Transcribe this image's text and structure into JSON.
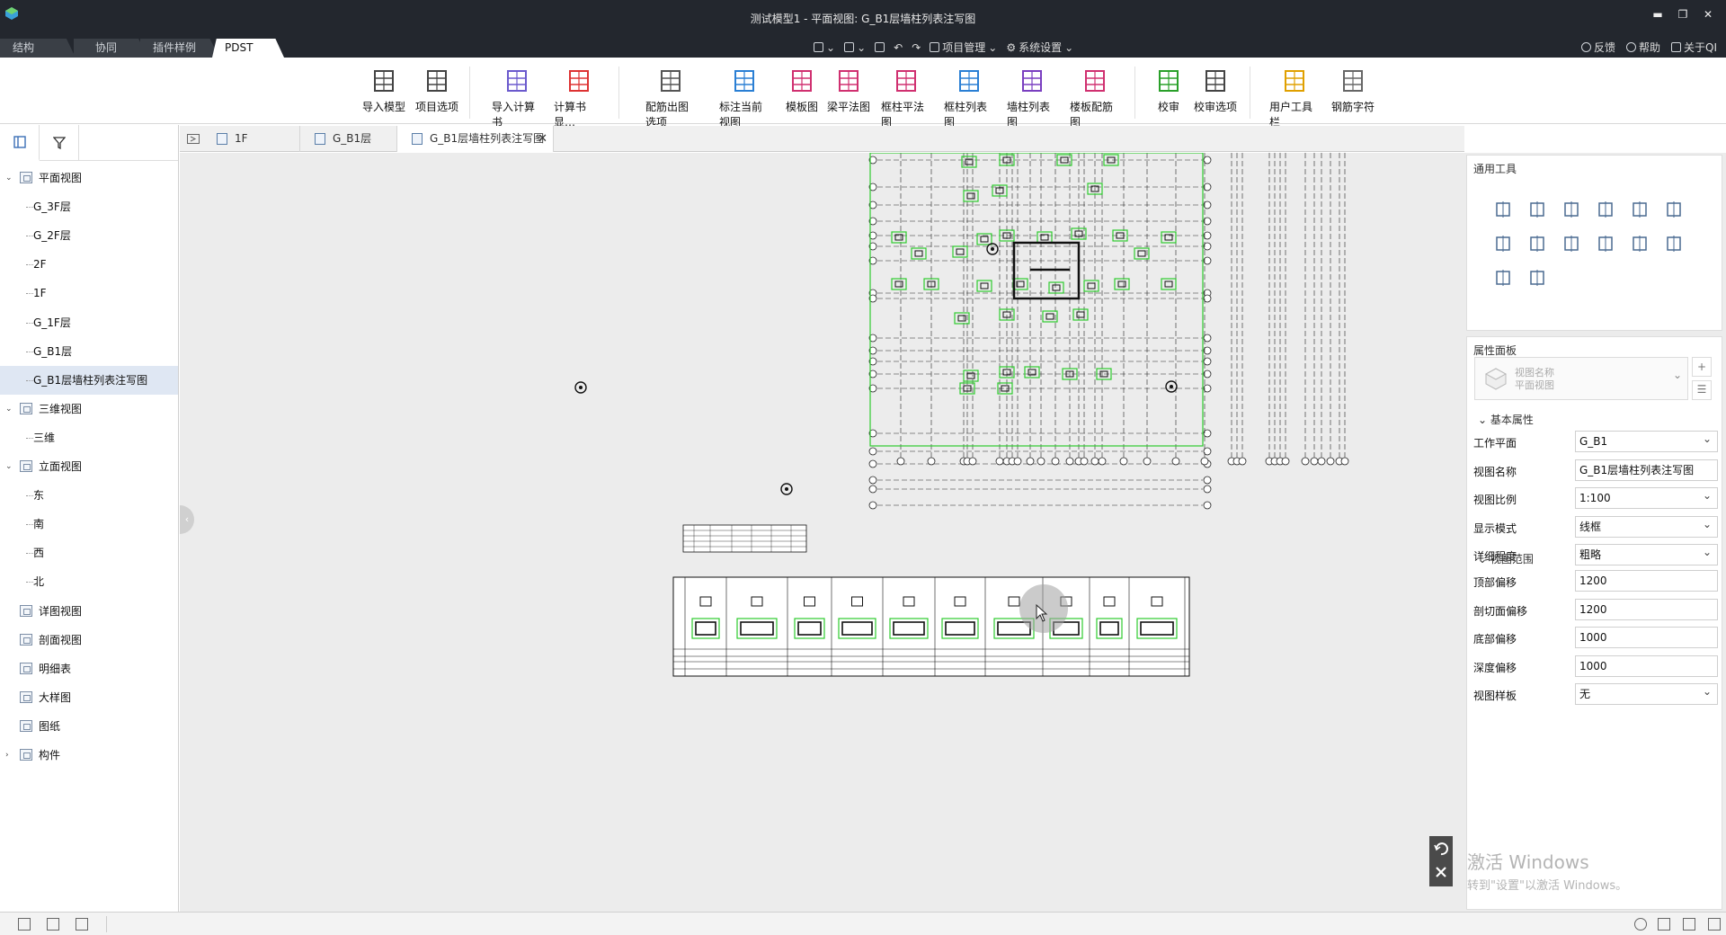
{
  "window": {
    "title": "测试模型1 - 平面视图: G_B1层墙柱列表注写图"
  },
  "ribbon_tabs": [
    {
      "label": "结构",
      "active": false
    },
    {
      "label": "协同",
      "active": false
    },
    {
      "label": "插件样例",
      "active": false
    },
    {
      "label": "PDST",
      "active": true
    }
  ],
  "quick_access": {
    "project": "项目管理",
    "system": "系统设置"
  },
  "help_menu": {
    "feedback": "反馈",
    "help": "帮助",
    "about": "关于QI"
  },
  "ribbon": [
    {
      "label": "导入模型",
      "icon": "building-icon"
    },
    {
      "label": "项目选项",
      "icon": "floors-icon"
    },
    {
      "label": "导入计算书",
      "icon": "import-calc-icon"
    },
    {
      "label": "计算书显…",
      "icon": "calc-display-icon"
    },
    {
      "label": "配筋出图选项",
      "icon": "gear-icon"
    },
    {
      "label": "标注当前视图",
      "icon": "annotate-view-icon"
    },
    {
      "label": "模板图",
      "icon": "template-icon"
    },
    {
      "label": "梁平法图",
      "icon": "beam-icon"
    },
    {
      "label": "框柱平法图",
      "icon": "column-icon"
    },
    {
      "label": "框柱列表图",
      "icon": "column-table-icon"
    },
    {
      "label": "墙柱列表图",
      "icon": "wall-table-icon"
    },
    {
      "label": "楼板配筋图",
      "icon": "slab-icon"
    },
    {
      "label": "校审",
      "icon": "check-icon"
    },
    {
      "label": "校审选项",
      "icon": "check-options-icon"
    },
    {
      "label": "用户工具栏",
      "icon": "star-icon"
    },
    {
      "label": "钢筋字符",
      "icon": "rebar-char-icon"
    }
  ],
  "tree": [
    {
      "label": "平面视图",
      "level": 0,
      "expand": "open",
      "icon": true
    },
    {
      "label": "G_3F层",
      "level": 1
    },
    {
      "label": "G_2F层",
      "level": 1
    },
    {
      "label": "2F",
      "level": 1
    },
    {
      "label": "1F",
      "level": 1
    },
    {
      "label": "G_1F层",
      "level": 1
    },
    {
      "label": "G_B1层",
      "level": 1
    },
    {
      "label": "G_B1层墙柱列表注写图",
      "level": 1,
      "selected": true
    },
    {
      "label": "三维视图",
      "level": 0,
      "expand": "open",
      "icon": true
    },
    {
      "label": "三维",
      "level": 1
    },
    {
      "label": "立面视图",
      "level": 0,
      "expand": "open",
      "icon": true
    },
    {
      "label": "东",
      "level": 1
    },
    {
      "label": "南",
      "level": 1
    },
    {
      "label": "西",
      "level": 1
    },
    {
      "label": "北",
      "level": 1
    },
    {
      "label": "详图视图",
      "level": 0,
      "icon": true
    },
    {
      "label": "剖面视图",
      "level": 0,
      "icon": true
    },
    {
      "label": "明细表",
      "level": 0,
      "icon": true
    },
    {
      "label": "大样图",
      "level": 0,
      "icon": true
    },
    {
      "label": "图纸",
      "level": 0,
      "icon": true
    },
    {
      "label": "构件",
      "level": 0,
      "expand": "closed",
      "icon": true
    }
  ],
  "doc_tabs": [
    {
      "label": "1F",
      "active": false
    },
    {
      "label": "G_B1层",
      "active": false
    },
    {
      "label": "G_B1层墙柱列表注写图",
      "active": true
    }
  ],
  "tools_panel": {
    "title": "通用工具"
  },
  "props_panel": {
    "title": "属性面板",
    "type_line1": "视图名称",
    "type_line2": "平面视图",
    "group_basic": "基本属性",
    "group_range": "视图范围",
    "basic": [
      {
        "label": "工作平面",
        "value": "G_B1",
        "select": true
      },
      {
        "label": "视图名称",
        "value": "G_B1层墙柱列表注写图",
        "select": false
      },
      {
        "label": "视图比例",
        "value": "1:100",
        "select": true
      },
      {
        "label": "显示模式",
        "value": "线框",
        "select": true
      },
      {
        "label": "详细程度",
        "value": "粗略",
        "select": true
      }
    ],
    "range": [
      {
        "label": "顶部偏移",
        "value": "1200",
        "select": false
      },
      {
        "label": "剖切面偏移",
        "value": "1200",
        "select": false
      },
      {
        "label": "底部偏移",
        "value": "1000",
        "select": false
      },
      {
        "label": "深度偏移",
        "value": "1000",
        "select": false
      },
      {
        "label": "视图样板",
        "value": "无",
        "select": true
      }
    ]
  },
  "watermark": {
    "line1": "激活 Windows",
    "line2": "转到\"设置\"以激活 Windows。"
  },
  "colors": {
    "titlebar": "#23272e",
    "cad_green": "#2ecc2e",
    "selection": "#dfe7f3"
  }
}
